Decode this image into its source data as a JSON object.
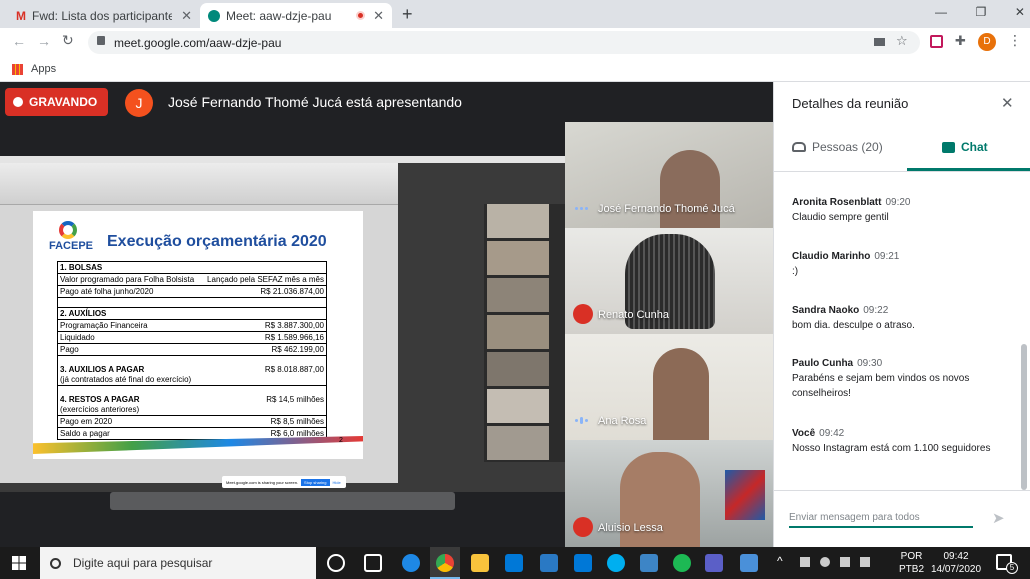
{
  "browser": {
    "tabs": [
      {
        "title": "Fwd: Lista dos participantes da reu"
      },
      {
        "title": "Meet: aaw-dzje-pau"
      }
    ],
    "url": "meet.google.com/aaw-dzje-pau",
    "bookmarks_label": "Apps",
    "profile_initial": "D"
  },
  "meet": {
    "recording_label": "GRAVANDO",
    "presenter_initial": "J",
    "presenter_text": "José Fernando Thomé Jucá está apresentando",
    "participants": [
      {
        "name": "José Fernando Thomé Jucá",
        "muted": false
      },
      {
        "name": "Renato Cunha",
        "muted": true
      },
      {
        "name": "Ana Rosa",
        "muted": false
      },
      {
        "name": "Aluisio Lessa",
        "muted": true
      }
    ]
  },
  "slide": {
    "logo": "FACEPE",
    "title": "Execução orçamentária 2020",
    "sections": [
      {
        "heading": "1. BOLSAS",
        "rows": [
          {
            "label": "Valor programado para Folha Bolsista",
            "value": "Lançado pela SEFAZ mês a mês"
          },
          {
            "label": "Pago até folha junho/2020",
            "value": "R$ 21.036.874,00"
          }
        ]
      },
      {
        "heading": "2. AUXÍLIOS",
        "rows": [
          {
            "label": "Programação Financeira",
            "value": "R$ 3.887.300,00"
          },
          {
            "label": "Liquidado",
            "value": "R$ 1.589.966,16"
          },
          {
            "label": "Pago",
            "value": "R$ 462.199,00"
          }
        ]
      },
      {
        "heading": "3. AUXILIOS A PAGAR",
        "sub": "(já contratados até final do exercício)",
        "value": "R$ 8.018.887,00"
      },
      {
        "heading": "4. RESTOS A PAGAR",
        "sub": "(exercícios anteriores)",
        "value": "R$ 14,5 milhões",
        "rows": [
          {
            "label": "Pago em 2020",
            "value": "R$ 8,5 milhões"
          },
          {
            "label": "Saldo a pagar",
            "value": "R$ 6,0 milhões"
          }
        ]
      }
    ],
    "page_number": "2",
    "share_notice": "Meet.google.com is sharing your screen.",
    "stop_sharing": "Stop sharing",
    "hide": "Hide"
  },
  "panel": {
    "title": "Detalhes da reunião",
    "tab_people": "Pessoas (20)",
    "tab_chat": "Chat",
    "messages": [
      {
        "sender": "Aronita Rosenblatt",
        "time": "09:20",
        "text": "Claudio sempre gentil"
      },
      {
        "sender": "Claudio Marinho",
        "time": "09:21",
        "text": ":)"
      },
      {
        "sender": "Sandra Naoko",
        "time": "09:22",
        "text": "bom dia. desculpe o atraso."
      },
      {
        "sender": "Paulo Cunha",
        "time": "09:30",
        "text": "Parabéns e sejam bem vindos os novos conselheiros!"
      },
      {
        "sender": "Você",
        "time": "09:42",
        "text": "Nosso Instagram está com 1.100 seguidores"
      }
    ],
    "input_placeholder": "Enviar mensagem para todos"
  },
  "taskbar": {
    "search_placeholder": "Digite aqui para pesquisar",
    "lang": "POR",
    "lang2": "PTB2",
    "time": "09:42",
    "date": "14/07/2020",
    "notif_count": "5"
  },
  "colors": {
    "accent_green": "#00796b",
    "record_red": "#d93025",
    "presenter_orange": "#f4511e",
    "slide_blue": "#1f4e9e"
  }
}
